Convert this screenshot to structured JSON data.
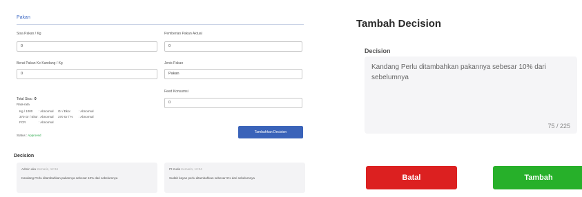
{
  "left": {
    "section_title": "Pakan",
    "fields": {
      "sisa_pakan_label": "Sisa Pakan / Kg",
      "sisa_pakan_value": "0",
      "berat_pakan_label": "Berat Pakan Ke Kandang / Kg",
      "berat_pakan_value": "0",
      "jenis_pakan_label": "Jenis Pakan",
      "jenis_pakan_value": "Pakan",
      "pemberian_label": "Pemberian Pakan Aktual",
      "pemberian_value": "0",
      "feed_label": "Feed Konsumsi",
      "feed_value": "0"
    },
    "stats": {
      "title_prefix": "Total Sisa :",
      "title_value": "0",
      "subtitle": "Rata-rata",
      "rows": [
        [
          "Kg / 1000",
          ": Abnormal",
          "Gr / Ekor",
          ": Abnormal"
        ],
        [
          "370 Gr / Ekor",
          ": Abnormal",
          "370 Gr / %",
          ": Abnormal"
        ],
        [
          "FCR",
          ": Abnormal",
          "",
          ""
        ]
      ],
      "status_prefix": "Status :",
      "status_value": "Approved"
    },
    "select_button": "Tambahkan Decision",
    "decision_heading": "Decision",
    "cards": [
      {
        "author": "Admin aku",
        "date": "Kemarin, 12:34",
        "text": "Kandang Perlu ditambahkan pakannya sebesar 10% dari sebelumnya"
      },
      {
        "author": "Pt Kuda",
        "date": "Kemarin, 12:34",
        "text": "Sudah kayan perlu ditambahkan sebesar 5% dari sebelumnya"
      }
    ]
  },
  "modal": {
    "title": "Tambah Decision",
    "field_label": "Decision",
    "value": "Kandang Perlu ditambahkan pakannya sebesar 10% dari sebelumnya",
    "counter": "75 / 225",
    "cancel_label": "Batal",
    "submit_label": "Tambah"
  },
  "colors": {
    "accent_blue": "#3a63b9",
    "cancel_red": "#dc2020",
    "submit_green": "#27b02a"
  }
}
